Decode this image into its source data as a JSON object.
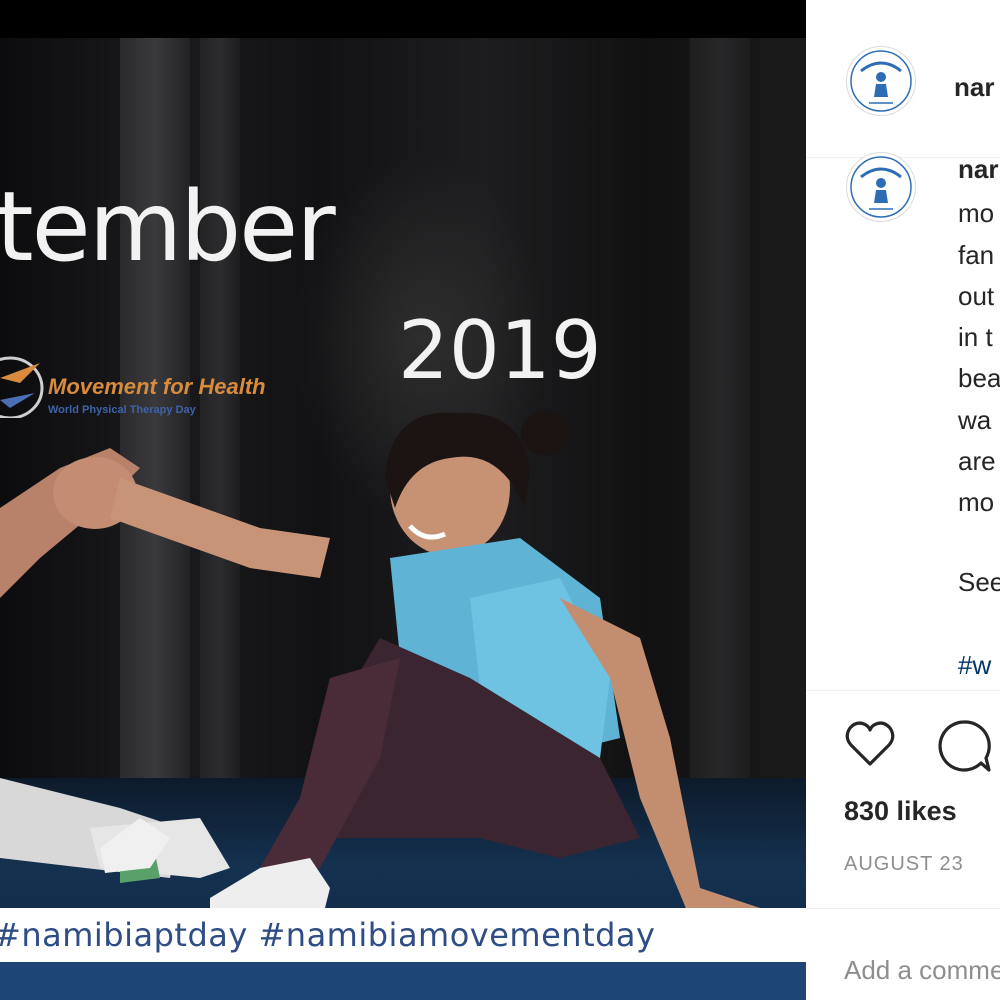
{
  "image": {
    "month_text": "tember",
    "year_text": "2019",
    "logo_title": "Movement for Health",
    "logo_subtitle": "World Physical Therapy Day",
    "hashtags": "namibiaptday #namibiamovementday"
  },
  "post": {
    "username": "nar",
    "caption_username": "nar",
    "caption_lines": [
      "mo",
      "fan",
      "out",
      "in t",
      "bea",
      "wa",
      "are",
      "mo"
    ],
    "see_more": "See",
    "hashtag": "#w",
    "likes": "830 likes",
    "date": "AUGUST 23",
    "comment_placeholder": "Add a comment..."
  },
  "icons": {
    "avatar": "physiotherapy-logo-icon",
    "like": "heart-icon",
    "comment": "comment-bubble-icon"
  },
  "colors": {
    "hashtag_blue": "#2f4d85",
    "logo_orange": "#d88b3c",
    "link_blue": "#003569",
    "muted_gray": "#8e8e8e"
  }
}
